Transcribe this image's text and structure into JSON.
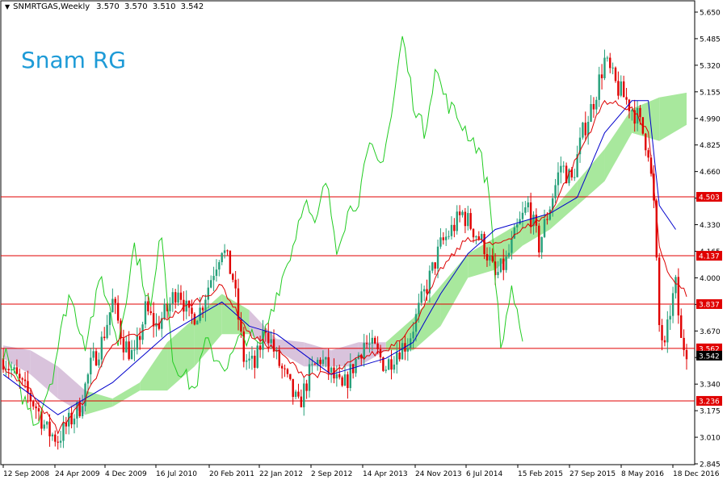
{
  "header": {
    "symbol": "SNMRTGAS,Weekly",
    "ohlc": [
      "3.570",
      "3.570",
      "3.510",
      "3.542"
    ]
  },
  "watermark": "Snam RG",
  "chart_data": {
    "type": "candlestick",
    "ylim": [
      2.845,
      5.72
    ],
    "y_ticks": [
      "5.650",
      "5.485",
      "5.320",
      "5.155",
      "4.990",
      "4.825",
      "4.660",
      "4.495",
      "4.330",
      "4.165",
      "4.000",
      "3.835",
      "3.670",
      "3.505",
      "3.340",
      "3.175",
      "3.010",
      "2.845"
    ],
    "x_ticks": [
      "12 Sep 2008",
      "24 Apr 2009",
      "4 Dec 2009",
      "16 Jul 2010",
      "20 Feb 2011",
      "22 Jan 2012",
      "2 Sep 2012",
      "14 Apr 2013",
      "24 Nov 2013",
      "6 Jul 2014",
      "15 Feb 2015",
      "27 Sep 2015",
      "8 May 2016",
      "18 Dec 2016"
    ],
    "levels": [
      {
        "value": 4.503,
        "label": "4.503"
      },
      {
        "value": 4.137,
        "label": "4.137"
      },
      {
        "value": 3.837,
        "label": "3.837"
      },
      {
        "value": 3.562,
        "label": "3.562"
      },
      {
        "value": 3.236,
        "label": "3.236"
      }
    ],
    "current_price": {
      "value": 3.542,
      "label": "3.542"
    },
    "price_path": [
      [
        0,
        3.5
      ],
      [
        4,
        3.4
      ],
      [
        8,
        3.3
      ],
      [
        12,
        3.2
      ],
      [
        16,
        3.05
      ],
      [
        20,
        3.0
      ],
      [
        24,
        3.1
      ],
      [
        28,
        3.2
      ],
      [
        32,
        3.45
      ],
      [
        36,
        3.6
      ],
      [
        40,
        3.85
      ],
      [
        44,
        3.6
      ],
      [
        48,
        3.5
      ],
      [
        52,
        3.8
      ],
      [
        56,
        3.7
      ],
      [
        60,
        3.8
      ],
      [
        64,
        3.95
      ],
      [
        68,
        3.75
      ],
      [
        72,
        3.8
      ],
      [
        76,
        4.0
      ],
      [
        80,
        4.2
      ],
      [
        84,
        4.0
      ],
      [
        88,
        3.5
      ],
      [
        92,
        3.45
      ],
      [
        96,
        3.7
      ],
      [
        100,
        3.5
      ],
      [
        104,
        3.35
      ],
      [
        108,
        3.2
      ],
      [
        112,
        3.4
      ],
      [
        116,
        3.5
      ],
      [
        120,
        3.4
      ],
      [
        124,
        3.3
      ],
      [
        128,
        3.45
      ],
      [
        132,
        3.6
      ],
      [
        136,
        3.55
      ],
      [
        140,
        3.45
      ],
      [
        144,
        3.55
      ],
      [
        148,
        3.6
      ],
      [
        152,
        3.8
      ],
      [
        156,
        4.0
      ],
      [
        160,
        4.2
      ],
      [
        164,
        4.3
      ],
      [
        168,
        4.4
      ],
      [
        172,
        4.3
      ],
      [
        176,
        4.2
      ],
      [
        180,
        4.0
      ],
      [
        184,
        4.1
      ],
      [
        188,
        4.3
      ],
      [
        192,
        4.45
      ],
      [
        196,
        4.2
      ],
      [
        200,
        4.45
      ],
      [
        204,
        4.7
      ],
      [
        208,
        4.6
      ],
      [
        212,
        4.9
      ],
      [
        216,
        5.1
      ],
      [
        220,
        5.35
      ],
      [
        224,
        5.2
      ],
      [
        228,
        5.1
      ],
      [
        232,
        5.0
      ],
      [
        236,
        4.8
      ],
      [
        238,
        4.45
      ],
      [
        240,
        3.7
      ],
      [
        242,
        3.55
      ],
      [
        244,
        3.8
      ],
      [
        246,
        3.95
      ],
      [
        248,
        3.6
      ],
      [
        250,
        3.56
      ]
    ],
    "tenkan_path": [
      [
        0,
        3.45
      ],
      [
        10,
        3.3
      ],
      [
        20,
        3.05
      ],
      [
        30,
        3.25
      ],
      [
        40,
        3.6
      ],
      [
        50,
        3.65
      ],
      [
        60,
        3.75
      ],
      [
        70,
        3.85
      ],
      [
        80,
        3.95
      ],
      [
        90,
        3.65
      ],
      [
        100,
        3.55
      ],
      [
        110,
        3.4
      ],
      [
        120,
        3.4
      ],
      [
        130,
        3.5
      ],
      [
        140,
        3.55
      ],
      [
        150,
        3.7
      ],
      [
        160,
        4.05
      ],
      [
        170,
        4.25
      ],
      [
        180,
        4.2
      ],
      [
        190,
        4.3
      ],
      [
        200,
        4.4
      ],
      [
        210,
        4.75
      ],
      [
        220,
        5.1
      ],
      [
        230,
        5.05
      ],
      [
        236,
        4.9
      ],
      [
        240,
        4.2
      ],
      [
        244,
        4.0
      ],
      [
        250,
        3.9
      ]
    ],
    "kijun_path": [
      [
        0,
        3.4
      ],
      [
        20,
        3.15
      ],
      [
        40,
        3.35
      ],
      [
        60,
        3.65
      ],
      [
        80,
        3.85
      ],
      [
        90,
        3.7
      ],
      [
        100,
        3.65
      ],
      [
        120,
        3.4
      ],
      [
        140,
        3.5
      ],
      [
        150,
        3.6
      ],
      [
        160,
        3.9
      ],
      [
        170,
        4.15
      ],
      [
        180,
        4.3
      ],
      [
        200,
        4.4
      ],
      [
        210,
        4.5
      ],
      [
        220,
        4.9
      ],
      [
        230,
        5.1
      ],
      [
        236,
        5.1
      ],
      [
        240,
        4.45
      ],
      [
        246,
        4.3
      ]
    ],
    "chikou_path": [
      [
        0,
        3.55
      ],
      [
        6,
        3.3
      ],
      [
        12,
        3.1
      ],
      [
        18,
        3.4
      ],
      [
        24,
        3.9
      ],
      [
        30,
        3.6
      ],
      [
        36,
        4.0
      ],
      [
        42,
        3.6
      ],
      [
        48,
        4.2
      ],
      [
        54,
        3.8
      ],
      [
        58,
        4.3
      ],
      [
        62,
        3.5
      ],
      [
        66,
        3.4
      ],
      [
        70,
        3.3
      ],
      [
        74,
        3.6
      ],
      [
        78,
        3.5
      ],
      [
        82,
        3.45
      ],
      [
        86,
        3.6
      ],
      [
        90,
        3.65
      ],
      [
        94,
        3.55
      ],
      [
        98,
        3.8
      ],
      [
        102,
        4.0
      ],
      [
        106,
        4.2
      ],
      [
        110,
        4.5
      ],
      [
        114,
        4.3
      ],
      [
        118,
        4.6
      ],
      [
        122,
        4.2
      ],
      [
        126,
        4.4
      ],
      [
        130,
        4.5
      ],
      [
        134,
        4.8
      ],
      [
        138,
        4.7
      ],
      [
        142,
        5.0
      ],
      [
        146,
        5.5
      ],
      [
        150,
        5.1
      ],
      [
        154,
        4.9
      ],
      [
        158,
        5.3
      ],
      [
        162,
        5.1
      ],
      [
        166,
        5.0
      ],
      [
        170,
        4.9
      ],
      [
        174,
        4.8
      ],
      [
        178,
        4.5
      ],
      [
        182,
        3.55
      ],
      [
        186,
        3.95
      ],
      [
        190,
        3.55
      ]
    ],
    "kumo_path": [
      [
        0,
        3.58,
        3.5
      ],
      [
        10,
        3.55,
        3.4
      ],
      [
        20,
        3.45,
        3.25
      ],
      [
        30,
        3.3,
        3.15
      ],
      [
        40,
        3.25,
        3.2
      ],
      [
        50,
        3.35,
        3.3
      ],
      [
        60,
        3.6,
        3.3
      ],
      [
        70,
        3.75,
        3.45
      ],
      [
        80,
        3.9,
        3.65
      ],
      [
        90,
        3.8,
        3.65
      ],
      [
        100,
        3.62,
        3.55
      ],
      [
        110,
        3.6,
        3.45
      ],
      [
        120,
        3.55,
        3.45
      ],
      [
        130,
        3.6,
        3.45
      ],
      [
        140,
        3.6,
        3.55
      ],
      [
        150,
        3.75,
        3.55
      ],
      [
        160,
        3.95,
        3.7
      ],
      [
        170,
        4.15,
        4.0
      ],
      [
        180,
        4.25,
        4.05
      ],
      [
        190,
        4.35,
        4.2
      ],
      [
        200,
        4.4,
        4.3
      ],
      [
        210,
        4.6,
        4.45
      ],
      [
        220,
        4.8,
        4.6
      ],
      [
        230,
        5.05,
        4.9
      ],
      [
        240,
        5.12,
        4.85
      ],
      [
        250,
        5.15,
        4.95
      ]
    ]
  }
}
